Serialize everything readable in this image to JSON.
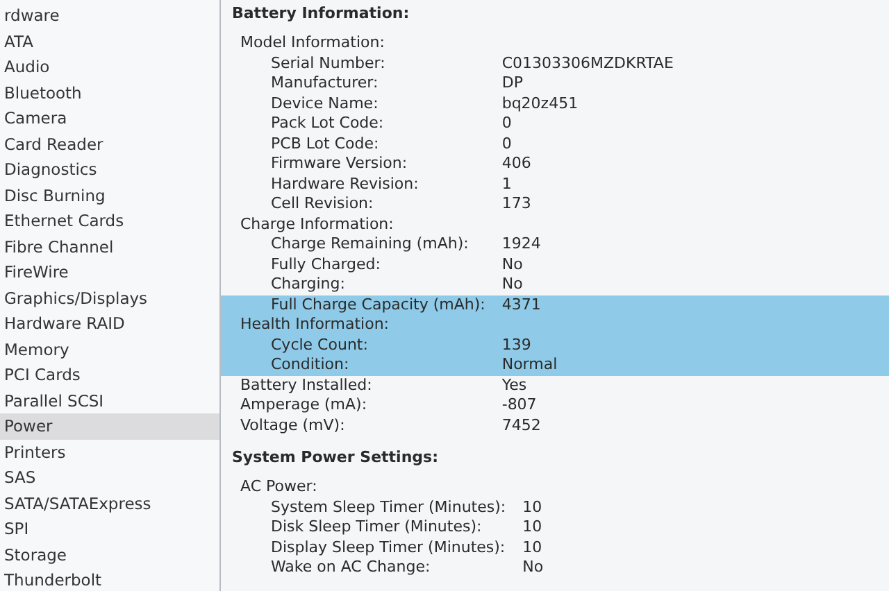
{
  "sidebar": {
    "items": [
      {
        "label": "rdware",
        "selected": false
      },
      {
        "label": "ATA",
        "selected": false
      },
      {
        "label": "Audio",
        "selected": false
      },
      {
        "label": "Bluetooth",
        "selected": false
      },
      {
        "label": "Camera",
        "selected": false
      },
      {
        "label": "Card Reader",
        "selected": false
      },
      {
        "label": "Diagnostics",
        "selected": false
      },
      {
        "label": "Disc Burning",
        "selected": false
      },
      {
        "label": "Ethernet Cards",
        "selected": false
      },
      {
        "label": "Fibre Channel",
        "selected": false
      },
      {
        "label": "FireWire",
        "selected": false
      },
      {
        "label": "Graphics/Displays",
        "selected": false
      },
      {
        "label": "Hardware RAID",
        "selected": false
      },
      {
        "label": "Memory",
        "selected": false
      },
      {
        "label": "PCI Cards",
        "selected": false
      },
      {
        "label": "Parallel SCSI",
        "selected": false
      },
      {
        "label": "Power",
        "selected": true
      },
      {
        "label": "Printers",
        "selected": false
      },
      {
        "label": "SAS",
        "selected": false
      },
      {
        "label": "SATA/SATAExpress",
        "selected": false
      },
      {
        "label": "SPI",
        "selected": false
      },
      {
        "label": "Storage",
        "selected": false
      },
      {
        "label": "Thunderbolt",
        "selected": false
      }
    ]
  },
  "detail": {
    "sections": [
      {
        "title": "Battery Information:",
        "nodes": [
          {
            "label": "Model Information:",
            "selected": false,
            "children": [
              {
                "label": "Serial Number:",
                "value": "C01303306MZDKRTAE",
                "selected": false
              },
              {
                "label": "Manufacturer:",
                "value": "DP",
                "selected": false
              },
              {
                "label": "Device Name:",
                "value": "bq20z451",
                "selected": false
              },
              {
                "label": "Pack Lot Code:",
                "value": "0",
                "selected": false
              },
              {
                "label": "PCB Lot Code:",
                "value": "0",
                "selected": false
              },
              {
                "label": "Firmware Version:",
                "value": "406",
                "selected": false
              },
              {
                "label": "Hardware Revision:",
                "value": "1",
                "selected": false
              },
              {
                "label": "Cell Revision:",
                "value": "173",
                "selected": false
              }
            ]
          },
          {
            "label": "Charge Information:",
            "selected": false,
            "children": [
              {
                "label": "Charge Remaining (mAh):",
                "value": "1924",
                "selected": false
              },
              {
                "label": "Fully Charged:",
                "value": "No",
                "selected": false
              },
              {
                "label": "Charging:",
                "value": "No",
                "selected": false
              },
              {
                "label": "Full Charge Capacity (mAh):",
                "value": "4371",
                "selected": true
              }
            ]
          },
          {
            "label": "Health Information:",
            "selected": true,
            "children": [
              {
                "label": "Cycle Count:",
                "value": "139",
                "selected": true
              },
              {
                "label": "Condition:",
                "value": "Normal",
                "selected": true
              }
            ]
          },
          {
            "label": "Battery Installed:",
            "value": "Yes",
            "selected": false
          },
          {
            "label": "Amperage (mA):",
            "value": "-807",
            "selected": false
          },
          {
            "label": "Voltage (mV):",
            "value": "7452",
            "selected": false
          }
        ]
      },
      {
        "title": "System Power Settings:",
        "nodes": [
          {
            "label": "AC Power:",
            "selected": false,
            "children": [
              {
                "label": "System Sleep Timer (Minutes):",
                "value": "10",
                "selected": false
              },
              {
                "label": "Disk Sleep Timer (Minutes):",
                "value": "10",
                "selected": false
              },
              {
                "label": "Display Sleep Timer (Minutes):",
                "value": "10",
                "selected": false
              },
              {
                "label": "Wake on AC Change:",
                "value": "No",
                "selected": false
              }
            ]
          }
        ]
      }
    ]
  }
}
